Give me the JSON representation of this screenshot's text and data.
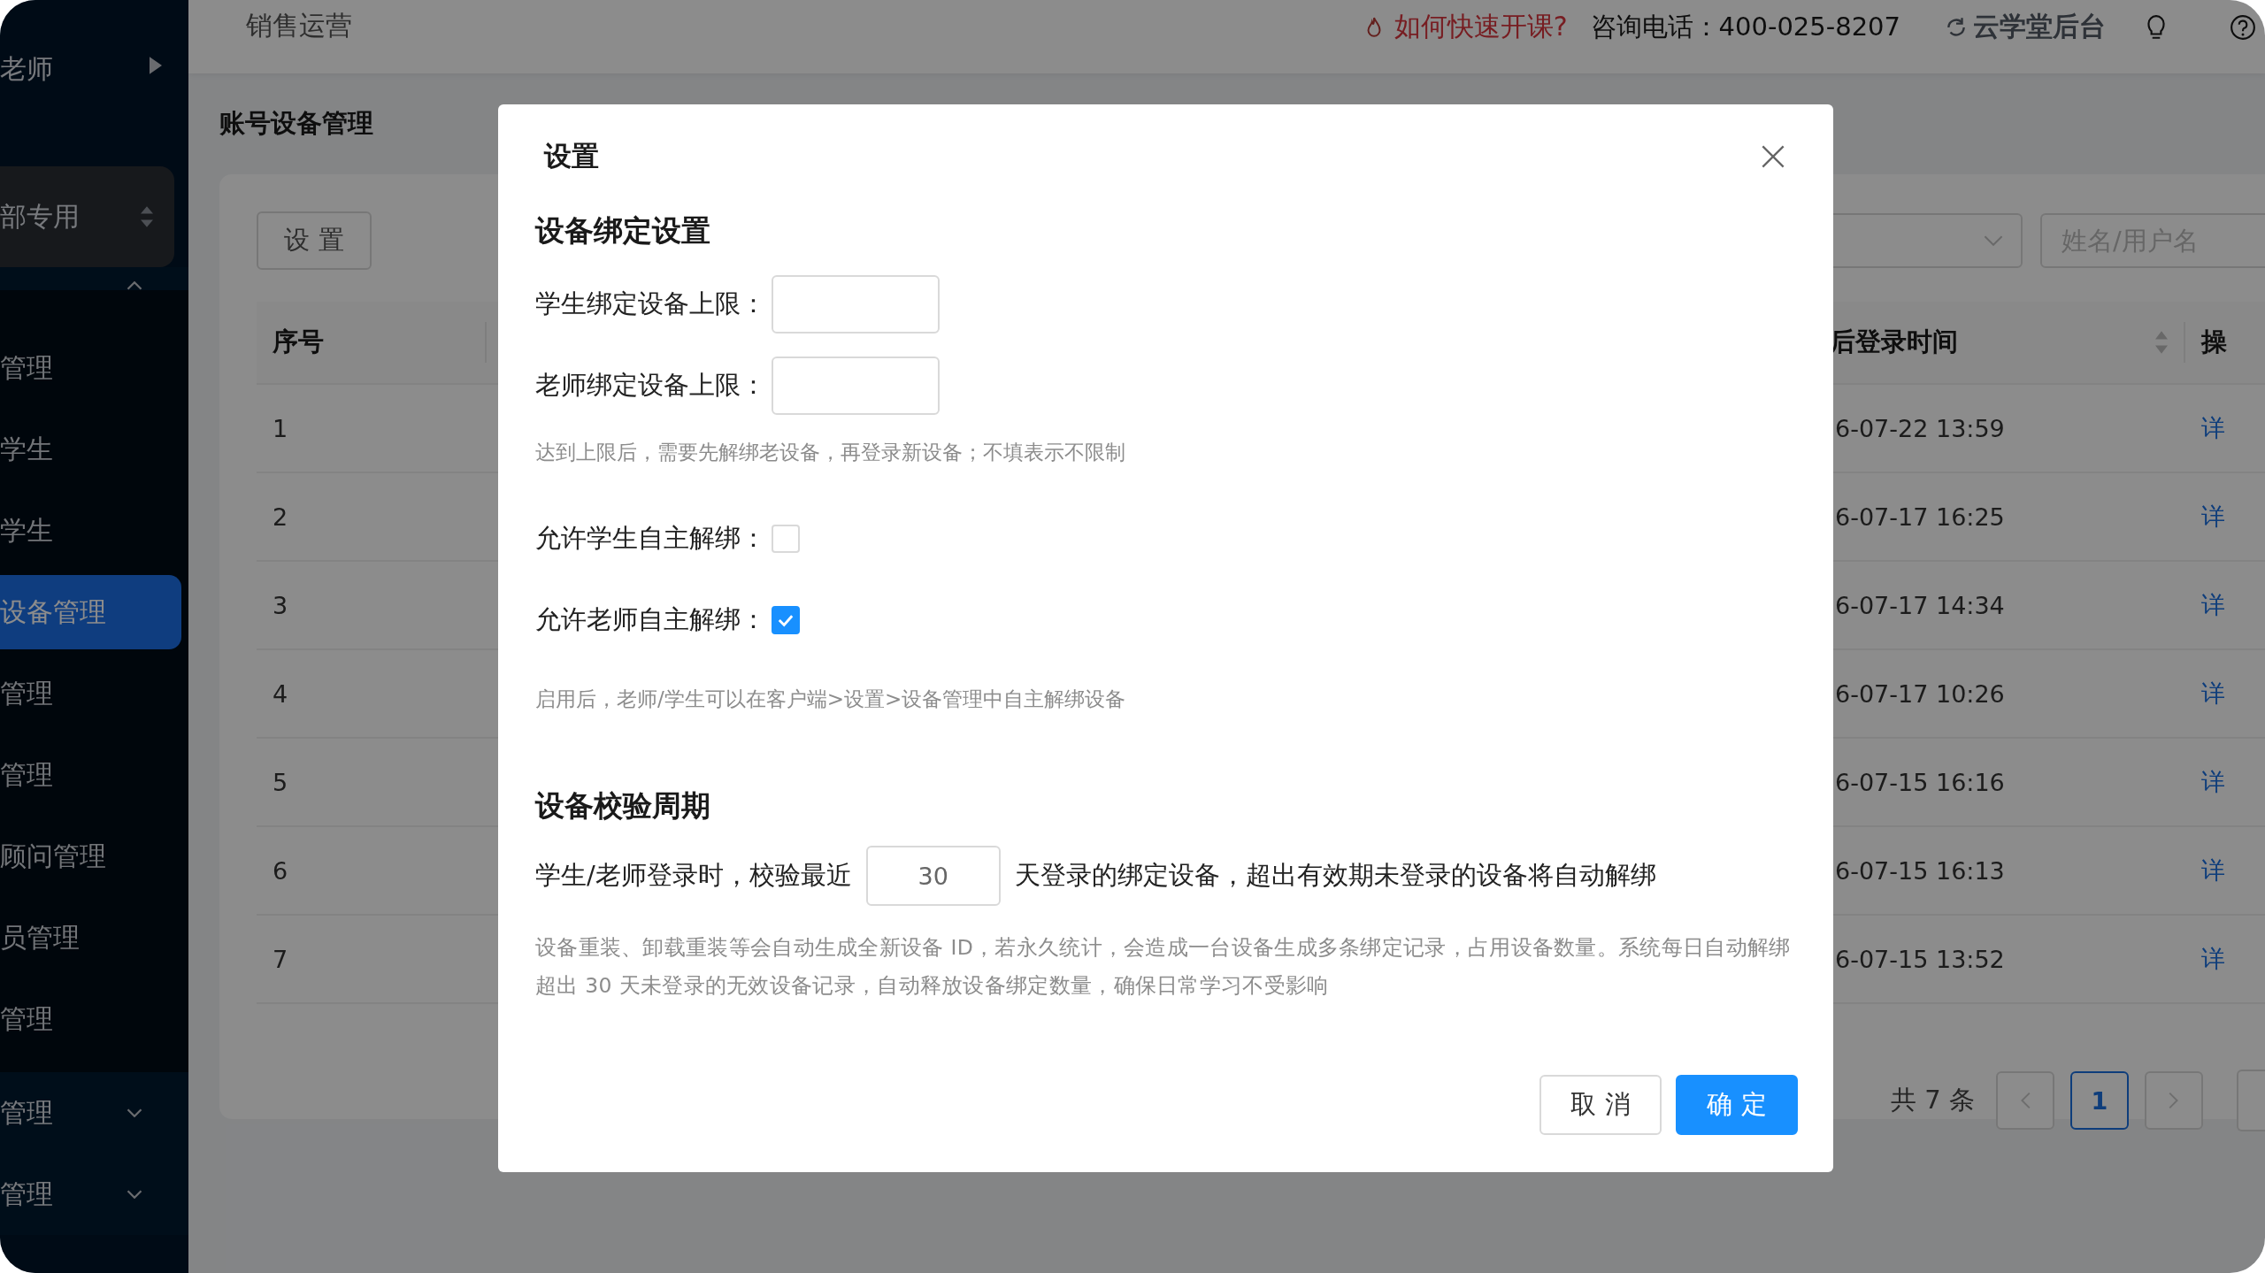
{
  "sidebar": {
    "user": "老师",
    "org_switch": "部专用",
    "groups": [
      {
        "expanded": true,
        "children": [
          {
            "label": "管理",
            "selected": false
          },
          {
            "label": "学生",
            "selected": false
          },
          {
            "label": "学生",
            "selected": false
          },
          {
            "label": "设备管理",
            "selected": true
          },
          {
            "label": "管理",
            "selected": false
          },
          {
            "label": "管理",
            "selected": false
          },
          {
            "label": "顾问管理",
            "selected": false
          },
          {
            "label": "员管理",
            "selected": false
          },
          {
            "label": "管理",
            "selected": false
          }
        ]
      },
      {
        "label": "管理",
        "expanded": false
      },
      {
        "label": "管理",
        "expanded": false
      }
    ]
  },
  "topbar": {
    "breadcrumb": "销售运营",
    "help_link": "如何快速开课?",
    "hotline": "咨询电话：400-025-8207",
    "admin_link": "云学堂后台"
  },
  "page_title": "账号设备管理",
  "toolbar": {
    "settings_button": "设 置",
    "search": {
      "placeholder": "姓名/用户名"
    }
  },
  "table": {
    "columns": [
      {
        "label": "序号",
        "sortable": false
      },
      {
        "label": "后登录时间",
        "sortable": true
      },
      {
        "label": "操",
        "sortable": false
      }
    ],
    "rows": [
      {
        "index": "1",
        "login_time": "6-07-22 13:59",
        "action": "详"
      },
      {
        "index": "2",
        "login_time": "6-07-17 16:25",
        "action": "详"
      },
      {
        "index": "3",
        "login_time": "6-07-17 14:34",
        "action": "详"
      },
      {
        "index": "4",
        "login_time": "6-07-17 10:26",
        "action": "详"
      },
      {
        "index": "5",
        "login_time": "6-07-15 16:16",
        "action": "详"
      },
      {
        "index": "6",
        "login_time": "6-07-15 16:13",
        "action": "详"
      },
      {
        "index": "7",
        "login_time": "6-07-15 13:52",
        "action": "详"
      }
    ]
  },
  "pagination": {
    "total": "共 7 条",
    "pages": [
      {
        "label": "1",
        "selected": true
      }
    ]
  },
  "dialog": {
    "title": "设置",
    "binding": {
      "heading": "设备绑定设置",
      "limits": [
        {
          "label": "学生绑定设备上限："
        },
        {
          "label": "老师绑定设备上限："
        }
      ],
      "limit_hint": "达到上限后，需要先解绑老设备，再登录新设备；不填表示不限制",
      "toggles": [
        {
          "label": "允许学生自主解绑：",
          "checked": false
        },
        {
          "label": "允许老师自主解绑：",
          "checked": true
        }
      ],
      "toggle_hint": "启用后，老师/学生可以在客户端>设置>设备管理中自主解绑设备"
    },
    "period": {
      "heading": "设备校验周期",
      "before": "学生/老师登录时，校验最近",
      "value": "30",
      "after": "天登录的绑定设备，超出有效期未登录的设备将自动解绑",
      "note": "设备重装、卸载重装等会自动生成全新设备 ID，若永久统计，会造成一台设备生成多条绑定记录，占用设备数量。系统每日自动解绑超出 30 天未登录的无效设备记录，自动释放设备绑定数量，确保日常学习不受影响"
    },
    "buttons": [
      {
        "label": "取 消",
        "kind": "secondary"
      },
      {
        "label": "确 定",
        "kind": "primary"
      }
    ]
  }
}
